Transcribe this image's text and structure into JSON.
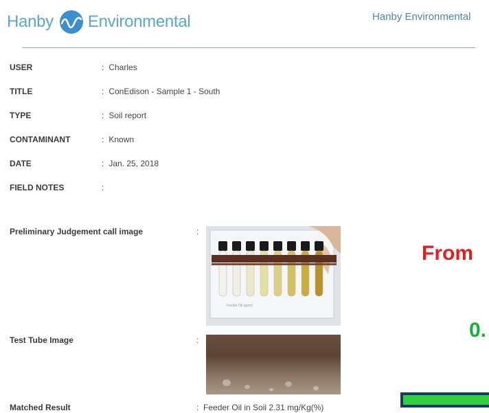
{
  "header": {
    "logo_left_word": "Hanby",
    "logo_right_word": "Environmental",
    "brand_right": "Hanby Environmental"
  },
  "fields": [
    {
      "label": "USER",
      "value": "Charles"
    },
    {
      "label": "TITLE",
      "value": "ConEdison - Sample 1 - South"
    },
    {
      "label": "TYPE",
      "value": "Soil report"
    },
    {
      "label": "CONTAMINANT",
      "value": "Known"
    },
    {
      "label": "DATE",
      "value": "Jan. 25, 2018"
    },
    {
      "label": "FIELD NOTES",
      "value": ""
    }
  ],
  "sections": {
    "preliminary_label": "Preliminary Judgement call image",
    "test_tube_label": "Test Tube Image",
    "matched_label": "Matched Result",
    "matched_value": "Feeder Oil in Soil 2.31 mg/Kg(%)"
  },
  "overlay": {
    "from_text": "From",
    "number_text": "0.",
    "progress_fraction": 1.0
  },
  "colors": {
    "brand_blue": "#5aa6d0",
    "accent_red": "#e02020",
    "accent_green": "#19b03a",
    "bar_border": "#1a3570",
    "bar_fill": "#2fd13f"
  }
}
